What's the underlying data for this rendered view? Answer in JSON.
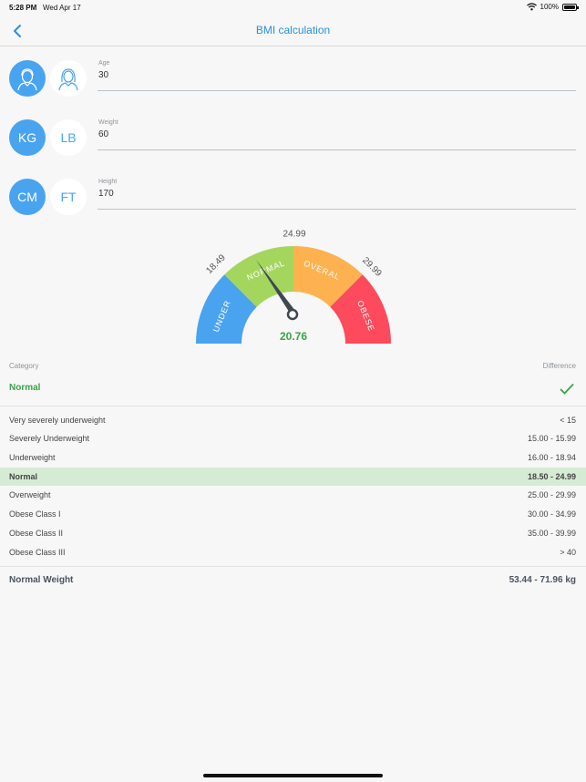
{
  "status": {
    "time": "5:28 PM",
    "date": "Wed Apr 17",
    "battery": "100%"
  },
  "nav": {
    "title": "BMI calculation"
  },
  "age": {
    "label": "Age",
    "value": "30"
  },
  "weight": {
    "label": "Weight",
    "value": "60",
    "unit_kg": "KG",
    "unit_lb": "LB"
  },
  "height": {
    "label": "Height",
    "value": "170",
    "unit_cm": "CM",
    "unit_ft": "FT"
  },
  "gauge": {
    "t1": "18.49",
    "t2": "24.99",
    "t3": "29.99",
    "under": "UNDER",
    "normal": "NORMAL",
    "overal": "OVERAL",
    "obese": "OBESE",
    "value": "20.76",
    "colors": {
      "under": "#4aa3ef",
      "normal": "#a4d65e",
      "overal": "#fdb24f",
      "obese": "#fd4a5c",
      "value": "#3aa346"
    }
  },
  "category": {
    "header": "Category",
    "difference_header": "Difference",
    "current": "Normal"
  },
  "ranges": [
    {
      "name": "Very severely underweight",
      "range": "< 15"
    },
    {
      "name": "Severely Underweight",
      "range": "15.00  - 15.99"
    },
    {
      "name": "Underweight",
      "range": "16.00 - 18.94"
    },
    {
      "name": "Normal",
      "range": "18.50  - 24.99",
      "highlight": true
    },
    {
      "name": "Overweight",
      "range": "25.00 - 29.99"
    },
    {
      "name": "Obese Class I",
      "range": "30.00 - 34.99"
    },
    {
      "name": "Obese Class II",
      "range": "35.00 - 39.99"
    },
    {
      "name": "Obese Class III",
      "range": "> 40"
    }
  ],
  "normal_weight": {
    "label": "Normal Weight",
    "value": "53.44 - 71.96 kg"
  }
}
